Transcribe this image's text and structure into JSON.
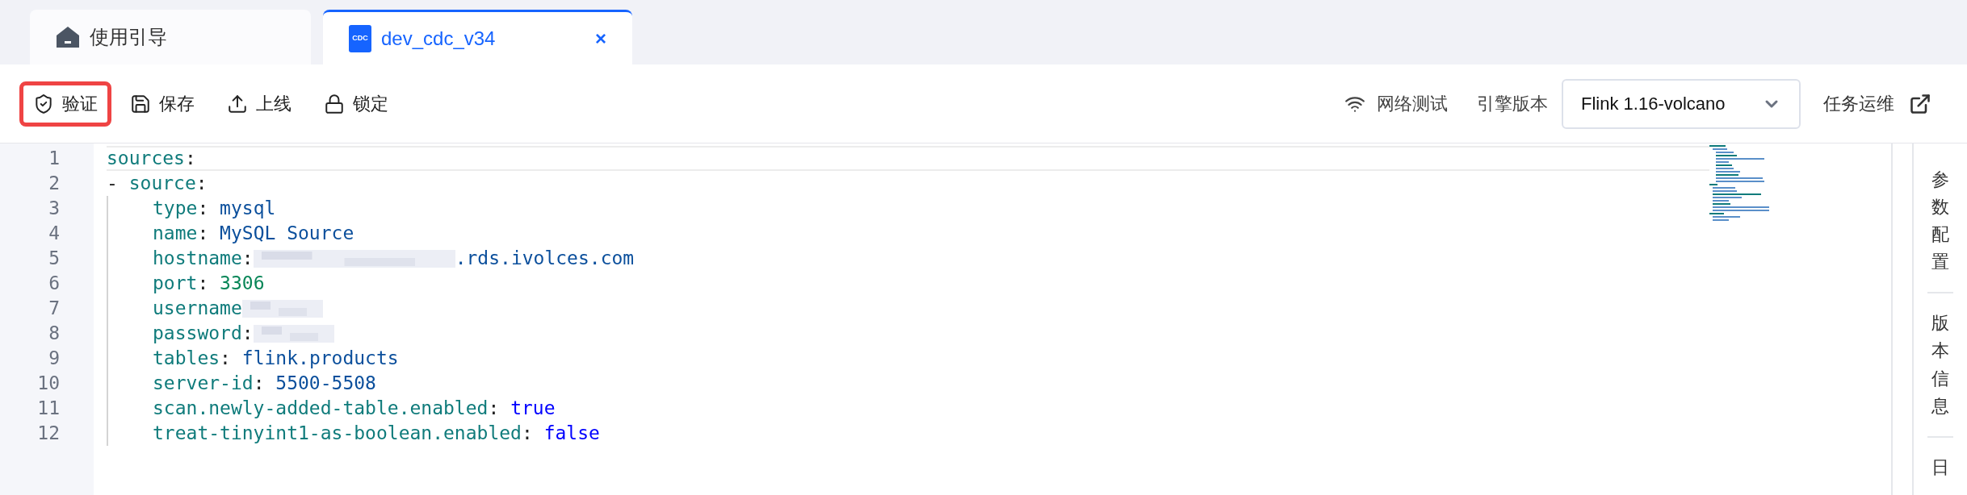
{
  "tabs": [
    {
      "label": "使用引导",
      "selected": false
    },
    {
      "label": "dev_cdc_v34",
      "selected": true,
      "icon_text": "CDC",
      "close": "×"
    }
  ],
  "toolbar": {
    "left": [
      {
        "label": "验证",
        "highlighted": true
      },
      {
        "label": "保存",
        "highlighted": false
      },
      {
        "label": "上线",
        "highlighted": false
      },
      {
        "label": "锁定",
        "highlighted": false
      }
    ],
    "network_test": "网络测试",
    "engine_label": "引擎版本",
    "engine_select": "Flink 1.16-volcano",
    "ops": "任务运维"
  },
  "editor": {
    "lines": [
      {
        "number": "1",
        "tokens": [
          {
            "kind": "key",
            "text": "sources"
          },
          {
            "kind": "punct",
            "text": ":"
          }
        ],
        "children": [
          {
            "number": "2",
            "tokens": [
              {
                "kind": "punct",
                "text": "- "
              },
              {
                "kind": "key",
                "text": "source"
              },
              {
                "kind": "punct",
                "text": ":"
              }
            ],
            "children": [
              {
                "number": "3",
                "tokens": [
                  {
                    "kind": "key",
                    "text": "type"
                  },
                  {
                    "kind": "punct",
                    "text": ": "
                  },
                  {
                    "kind": "string",
                    "text": "mysql"
                  }
                ]
              },
              {
                "number": "4",
                "tokens": [
                  {
                    "kind": "key",
                    "text": "name"
                  },
                  {
                    "kind": "punct",
                    "text": ": "
                  },
                  {
                    "kind": "string",
                    "text": "MySQL Source"
                  }
                ]
              },
              {
                "number": "5",
                "tokens": [
                  {
                    "kind": "key",
                    "text": "hostname"
                  },
                  {
                    "kind": "punct",
                    "text": ":"
                  },
                  {
                    "kind": "redacted"
                  },
                  {
                    "kind": "string",
                    "text": ".rds.ivolces.com"
                  }
                ]
              },
              {
                "number": "6",
                "tokens": [
                  {
                    "kind": "key",
                    "text": "port"
                  },
                  {
                    "kind": "punct",
                    "text": ": "
                  },
                  {
                    "kind": "number",
                    "text": "3306"
                  }
                ]
              },
              {
                "number": "7",
                "tokens": [
                  {
                    "kind": "key",
                    "text": "username"
                  },
                  {
                    "kind": "redacted"
                  }
                ]
              },
              {
                "number": "8",
                "tokens": [
                  {
                    "kind": "key",
                    "text": "password"
                  },
                  {
                    "kind": "punct",
                    "text": ":"
                  },
                  {
                    "kind": "redacted"
                  }
                ]
              },
              {
                "number": "9",
                "tokens": [
                  {
                    "kind": "key",
                    "text": "tables"
                  },
                  {
                    "kind": "punct",
                    "text": ": "
                  },
                  {
                    "kind": "string",
                    "text": "flink.products"
                  }
                ]
              },
              {
                "number": "10",
                "tokens": [
                  {
                    "kind": "key",
                    "text": "server-id"
                  },
                  {
                    "kind": "punct",
                    "text": ": "
                  },
                  {
                    "kind": "string",
                    "text": "5500-5508"
                  }
                ]
              },
              {
                "number": "11",
                "tokens": [
                  {
                    "kind": "key",
                    "text": "scan.newly-added-table.enabled"
                  },
                  {
                    "kind": "punct",
                    "text": ": "
                  },
                  {
                    "kind": "boolean",
                    "text": "true"
                  }
                ]
              },
              {
                "number": "12",
                "tokens": [
                  {
                    "kind": "key",
                    "text": "treat-tinyint1-as-boolean.enabled"
                  },
                  {
                    "kind": "punct",
                    "text": ": "
                  },
                  {
                    "kind": "boolean",
                    "text": "false"
                  }
                ]
              }
            ]
          }
        ]
      }
    ]
  },
  "side_panel": [
    {
      "label": "参数配置"
    },
    {
      "label": "版本信息"
    },
    {
      "label": "日"
    }
  ]
}
